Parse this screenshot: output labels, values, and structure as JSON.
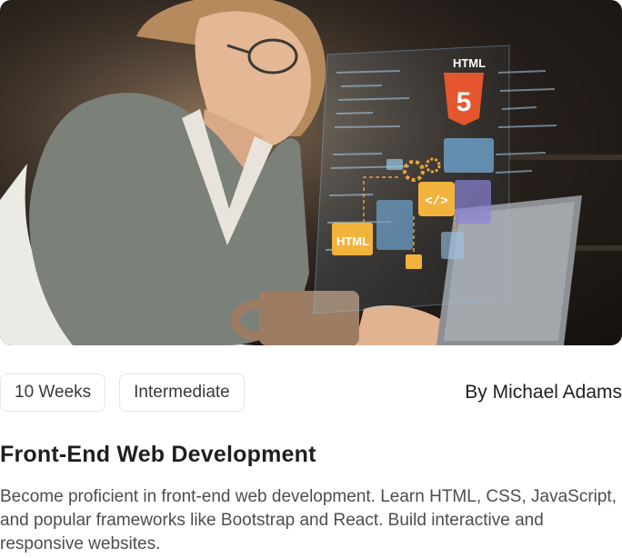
{
  "course": {
    "image_alt": "Woman coding on laptop with holographic HTML interface",
    "duration": "10 Weeks",
    "level": "Intermediate",
    "author": "By Michael Adams",
    "title": "Front-End Web Development",
    "description": "Become proficient in front-end web development. Learn HTML, CSS, JavaScript, and popular frameworks like Bootstrap and React. Build interactive and responsive websites."
  },
  "hero_labels": {
    "html_badge": "HTML",
    "html5_number": "5",
    "html_card": "HTML",
    "code_symbol": "</>"
  },
  "colors": {
    "accent_orange": "#e8a23a",
    "html5_shield": "#e4572e",
    "holo_blue": "#7fb4d9"
  }
}
